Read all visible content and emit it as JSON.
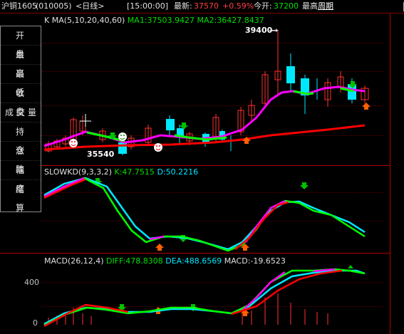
{
  "header": {
    "symbol": "沪铜1605",
    "code": "(010005)",
    "period": "<日线>",
    "time": "[15:00:00]",
    "latest_label": "最新:",
    "latest_value": "37570",
    "change_pct": "+0.59%",
    "open_label": "今开:",
    "open_value": "37200",
    "high_label": "最高",
    "cycle_link": "周期",
    "window_icons": [
      "grid-icon",
      "minimize-icon",
      "restore-icon",
      "close-icon"
    ]
  },
  "main_panel": {
    "k_label": "K",
    "ma_label": "MA(5,10,20,40,60)",
    "ma1": "MA1:37503.9427",
    "ma2": "MA2:36427.8437",
    "high_annotation": "39400",
    "low_annotation": "35540"
  },
  "side_menu": {
    "items": [
      "开盘",
      "最高",
      "最低",
      "收盘",
      "成交量",
      "持仓",
      "涨跌",
      "幅度",
      "结算"
    ]
  },
  "kd_panel": {
    "label": "SLOWKD(9,3,3,2)",
    "k_value": "K:47.7515",
    "d_value": "D:50.2216"
  },
  "macd_panel": {
    "label": "MACD(26,12,4)",
    "diff": "DIFF:478.8308",
    "dea": "DEA:488.6569",
    "macd": "MACD:-19.6523",
    "axis_labels": [
      "400",
      "0"
    ]
  },
  "colors": {
    "up": "#ff3030",
    "down": "#00e8ff",
    "ma_magenta": "#ff00ff",
    "ma_green": "#00ff00",
    "ma_red": "#ff0000",
    "border": "#b00000"
  }
}
